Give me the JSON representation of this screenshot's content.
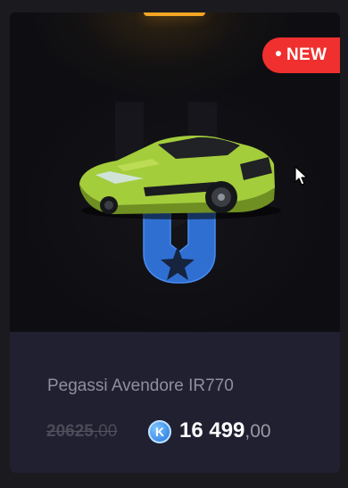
{
  "badge": {
    "label": "NEW",
    "color": "#f0302e"
  },
  "item": {
    "name": "Pegassi Avendore IR770"
  },
  "price": {
    "old_integer": "20625",
    "old_decimal": ",00",
    "currency_icon": "k-coin-icon",
    "currency_letter": "K",
    "new_integer": "16 499",
    "new_decimal": ",00"
  },
  "colors": {
    "accent": "#f5a623",
    "card_info_bg": "#202030",
    "car_body": "#a4cd3c"
  }
}
